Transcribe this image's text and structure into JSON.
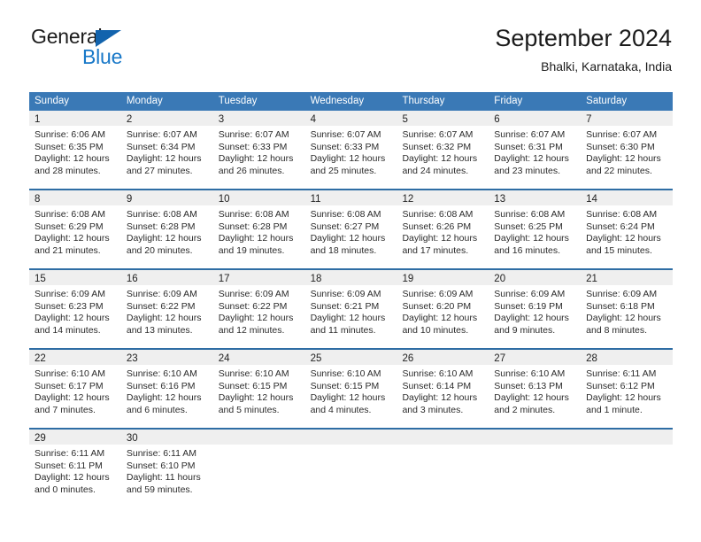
{
  "brand": {
    "word_one": "General",
    "word_two": "Blue",
    "triangle_icon": "blue-triangle-logo-icon",
    "colors": {
      "general_text": "#1b1b1b",
      "blue_text": "#1878c8",
      "triangle": "#1263ad"
    }
  },
  "header": {
    "title": "September 2024",
    "subtitle": "Bhalki, Karnataka, India"
  },
  "calendar": {
    "accent_color": "#3a79b6",
    "row_border_color": "#2e6da4",
    "date_strip_color": "#efefef",
    "weekdays": [
      "Sunday",
      "Monday",
      "Tuesday",
      "Wednesday",
      "Thursday",
      "Friday",
      "Saturday"
    ],
    "weeks": [
      [
        {
          "day": "1",
          "sunrise": "Sunrise: 6:06 AM",
          "sunset": "Sunset: 6:35 PM",
          "daylight_line1": "Daylight: 12 hours",
          "daylight_line2": "and 28 minutes."
        },
        {
          "day": "2",
          "sunrise": "Sunrise: 6:07 AM",
          "sunset": "Sunset: 6:34 PM",
          "daylight_line1": "Daylight: 12 hours",
          "daylight_line2": "and 27 minutes."
        },
        {
          "day": "3",
          "sunrise": "Sunrise: 6:07 AM",
          "sunset": "Sunset: 6:33 PM",
          "daylight_line1": "Daylight: 12 hours",
          "daylight_line2": "and 26 minutes."
        },
        {
          "day": "4",
          "sunrise": "Sunrise: 6:07 AM",
          "sunset": "Sunset: 6:33 PM",
          "daylight_line1": "Daylight: 12 hours",
          "daylight_line2": "and 25 minutes."
        },
        {
          "day": "5",
          "sunrise": "Sunrise: 6:07 AM",
          "sunset": "Sunset: 6:32 PM",
          "daylight_line1": "Daylight: 12 hours",
          "daylight_line2": "and 24 minutes."
        },
        {
          "day": "6",
          "sunrise": "Sunrise: 6:07 AM",
          "sunset": "Sunset: 6:31 PM",
          "daylight_line1": "Daylight: 12 hours",
          "daylight_line2": "and 23 minutes."
        },
        {
          "day": "7",
          "sunrise": "Sunrise: 6:07 AM",
          "sunset": "Sunset: 6:30 PM",
          "daylight_line1": "Daylight: 12 hours",
          "daylight_line2": "and 22 minutes."
        }
      ],
      [
        {
          "day": "8",
          "sunrise": "Sunrise: 6:08 AM",
          "sunset": "Sunset: 6:29 PM",
          "daylight_line1": "Daylight: 12 hours",
          "daylight_line2": "and 21 minutes."
        },
        {
          "day": "9",
          "sunrise": "Sunrise: 6:08 AM",
          "sunset": "Sunset: 6:28 PM",
          "daylight_line1": "Daylight: 12 hours",
          "daylight_line2": "and 20 minutes."
        },
        {
          "day": "10",
          "sunrise": "Sunrise: 6:08 AM",
          "sunset": "Sunset: 6:28 PM",
          "daylight_line1": "Daylight: 12 hours",
          "daylight_line2": "and 19 minutes."
        },
        {
          "day": "11",
          "sunrise": "Sunrise: 6:08 AM",
          "sunset": "Sunset: 6:27 PM",
          "daylight_line1": "Daylight: 12 hours",
          "daylight_line2": "and 18 minutes."
        },
        {
          "day": "12",
          "sunrise": "Sunrise: 6:08 AM",
          "sunset": "Sunset: 6:26 PM",
          "daylight_line1": "Daylight: 12 hours",
          "daylight_line2": "and 17 minutes."
        },
        {
          "day": "13",
          "sunrise": "Sunrise: 6:08 AM",
          "sunset": "Sunset: 6:25 PM",
          "daylight_line1": "Daylight: 12 hours",
          "daylight_line2": "and 16 minutes."
        },
        {
          "day": "14",
          "sunrise": "Sunrise: 6:08 AM",
          "sunset": "Sunset: 6:24 PM",
          "daylight_line1": "Daylight: 12 hours",
          "daylight_line2": "and 15 minutes."
        }
      ],
      [
        {
          "day": "15",
          "sunrise": "Sunrise: 6:09 AM",
          "sunset": "Sunset: 6:23 PM",
          "daylight_line1": "Daylight: 12 hours",
          "daylight_line2": "and 14 minutes."
        },
        {
          "day": "16",
          "sunrise": "Sunrise: 6:09 AM",
          "sunset": "Sunset: 6:22 PM",
          "daylight_line1": "Daylight: 12 hours",
          "daylight_line2": "and 13 minutes."
        },
        {
          "day": "17",
          "sunrise": "Sunrise: 6:09 AM",
          "sunset": "Sunset: 6:22 PM",
          "daylight_line1": "Daylight: 12 hours",
          "daylight_line2": "and 12 minutes."
        },
        {
          "day": "18",
          "sunrise": "Sunrise: 6:09 AM",
          "sunset": "Sunset: 6:21 PM",
          "daylight_line1": "Daylight: 12 hours",
          "daylight_line2": "and 11 minutes."
        },
        {
          "day": "19",
          "sunrise": "Sunrise: 6:09 AM",
          "sunset": "Sunset: 6:20 PM",
          "daylight_line1": "Daylight: 12 hours",
          "daylight_line2": "and 10 minutes."
        },
        {
          "day": "20",
          "sunrise": "Sunrise: 6:09 AM",
          "sunset": "Sunset: 6:19 PM",
          "daylight_line1": "Daylight: 12 hours",
          "daylight_line2": "and 9 minutes."
        },
        {
          "day": "21",
          "sunrise": "Sunrise: 6:09 AM",
          "sunset": "Sunset: 6:18 PM",
          "daylight_line1": "Daylight: 12 hours",
          "daylight_line2": "and 8 minutes."
        }
      ],
      [
        {
          "day": "22",
          "sunrise": "Sunrise: 6:10 AM",
          "sunset": "Sunset: 6:17 PM",
          "daylight_line1": "Daylight: 12 hours",
          "daylight_line2": "and 7 minutes."
        },
        {
          "day": "23",
          "sunrise": "Sunrise: 6:10 AM",
          "sunset": "Sunset: 6:16 PM",
          "daylight_line1": "Daylight: 12 hours",
          "daylight_line2": "and 6 minutes."
        },
        {
          "day": "24",
          "sunrise": "Sunrise: 6:10 AM",
          "sunset": "Sunset: 6:15 PM",
          "daylight_line1": "Daylight: 12 hours",
          "daylight_line2": "and 5 minutes."
        },
        {
          "day": "25",
          "sunrise": "Sunrise: 6:10 AM",
          "sunset": "Sunset: 6:15 PM",
          "daylight_line1": "Daylight: 12 hours",
          "daylight_line2": "and 4 minutes."
        },
        {
          "day": "26",
          "sunrise": "Sunrise: 6:10 AM",
          "sunset": "Sunset: 6:14 PM",
          "daylight_line1": "Daylight: 12 hours",
          "daylight_line2": "and 3 minutes."
        },
        {
          "day": "27",
          "sunrise": "Sunrise: 6:10 AM",
          "sunset": "Sunset: 6:13 PM",
          "daylight_line1": "Daylight: 12 hours",
          "daylight_line2": "and 2 minutes."
        },
        {
          "day": "28",
          "sunrise": "Sunrise: 6:11 AM",
          "sunset": "Sunset: 6:12 PM",
          "daylight_line1": "Daylight: 12 hours",
          "daylight_line2": "and 1 minute."
        }
      ],
      [
        {
          "day": "29",
          "sunrise": "Sunrise: 6:11 AM",
          "sunset": "Sunset: 6:11 PM",
          "daylight_line1": "Daylight: 12 hours",
          "daylight_line2": "and 0 minutes."
        },
        {
          "day": "30",
          "sunrise": "Sunrise: 6:11 AM",
          "sunset": "Sunset: 6:10 PM",
          "daylight_line1": "Daylight: 11 hours",
          "daylight_line2": "and 59 minutes."
        },
        {
          "day": "",
          "sunrise": "",
          "sunset": "",
          "daylight_line1": "",
          "daylight_line2": ""
        },
        {
          "day": "",
          "sunrise": "",
          "sunset": "",
          "daylight_line1": "",
          "daylight_line2": ""
        },
        {
          "day": "",
          "sunrise": "",
          "sunset": "",
          "daylight_line1": "",
          "daylight_line2": ""
        },
        {
          "day": "",
          "sunrise": "",
          "sunset": "",
          "daylight_line1": "",
          "daylight_line2": ""
        },
        {
          "day": "",
          "sunrise": "",
          "sunset": "",
          "daylight_line1": "",
          "daylight_line2": ""
        }
      ]
    ]
  }
}
